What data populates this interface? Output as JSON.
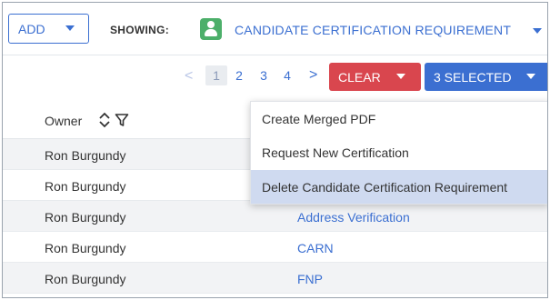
{
  "toolbar": {
    "add_label": "ADD",
    "showing_label": "SHOWING:",
    "entity_name": "CANDIDATE CERTIFICATION REQUIREMENT",
    "entity_icon": "person-badge-icon"
  },
  "pagination": {
    "prev": "<",
    "pages": [
      "1",
      "2",
      "3",
      "4"
    ],
    "active_page": "1",
    "next": ">"
  },
  "actions": {
    "clear_label": "CLEAR",
    "selected_label": "3 SELECTED"
  },
  "table": {
    "columns": {
      "owner": "Owner"
    },
    "rows": [
      {
        "owner": "Ron Burgundy",
        "requirement": ""
      },
      {
        "owner": "Ron Burgundy",
        "requirement": ""
      },
      {
        "owner": "Ron Burgundy",
        "requirement": "Address Verification"
      },
      {
        "owner": "Ron Burgundy",
        "requirement": "CARN"
      },
      {
        "owner": "Ron Burgundy",
        "requirement": "FNP"
      }
    ]
  },
  "menu": {
    "items": [
      "Create Merged PDF",
      "Request New Certification",
      "Delete Candidate Certification Requirement"
    ],
    "highlighted_index": 2
  },
  "colors": {
    "accent": "#3b6fd1",
    "danger": "#d9464e",
    "icon_green": "#4caf6a",
    "menu_highlight": "#cfdaf0"
  }
}
